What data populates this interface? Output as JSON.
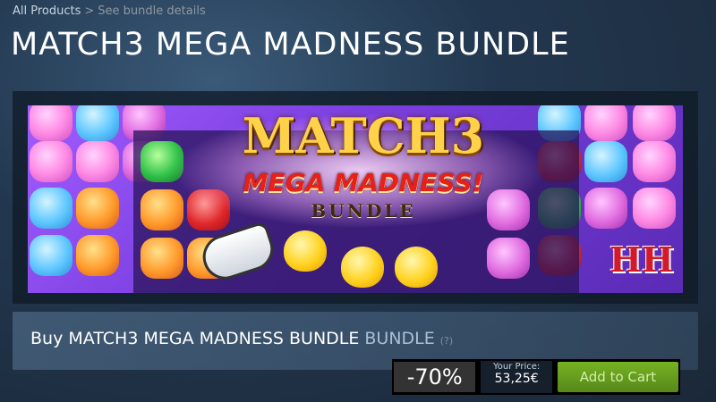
{
  "breadcrumb": {
    "root": "All Products",
    "separator": ">",
    "current": "See bundle details"
  },
  "page_title": "MATCH3 MEGA MADNESS BUNDLE",
  "banner": {
    "logo_main": "MATCH3",
    "logo_sub": "MEGA MADNESS!",
    "logo_bundle": "BUNDLE",
    "publisher_mark": "HH"
  },
  "purchase": {
    "buy_text": "Buy MATCH3 MEGA MADNESS BUNDLE",
    "bundle_tag": "BUNDLE",
    "help_mark": "(?)",
    "discount": "-70%",
    "price_label": "Your Price:",
    "price_value": "53,25€",
    "cart_label": "Add to Cart"
  },
  "colors": {
    "background": "#1b2838",
    "cart_button": "#75b022",
    "discount_bg": "#333333"
  }
}
